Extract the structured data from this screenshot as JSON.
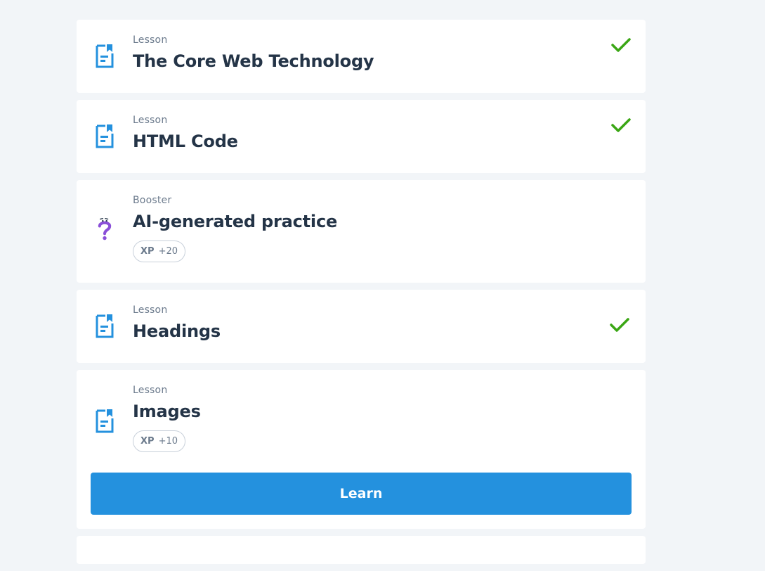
{
  "lessons": [
    {
      "type": "Lesson",
      "title": "The Core Web Technology",
      "completed": true,
      "icon": "lesson-doc-icon"
    },
    {
      "type": "Lesson",
      "title": "HTML Code",
      "completed": true,
      "icon": "lesson-doc-icon"
    },
    {
      "type": "Booster",
      "title": "AI-generated practice",
      "completed": false,
      "icon": "question-mark-icon",
      "xp_label": "XP",
      "xp_value": "+20"
    },
    {
      "type": "Lesson",
      "title": "Headings",
      "completed": true,
      "icon": "lesson-doc-icon"
    },
    {
      "type": "Lesson",
      "title": "Images",
      "completed": false,
      "icon": "lesson-doc-icon",
      "xp_label": "XP",
      "xp_value": "+10",
      "action_label": "Learn"
    }
  ],
  "colors": {
    "accent": "#2491de",
    "check": "#3aa614",
    "booster": "#8a4fd8",
    "background": "#f2f5f8"
  }
}
